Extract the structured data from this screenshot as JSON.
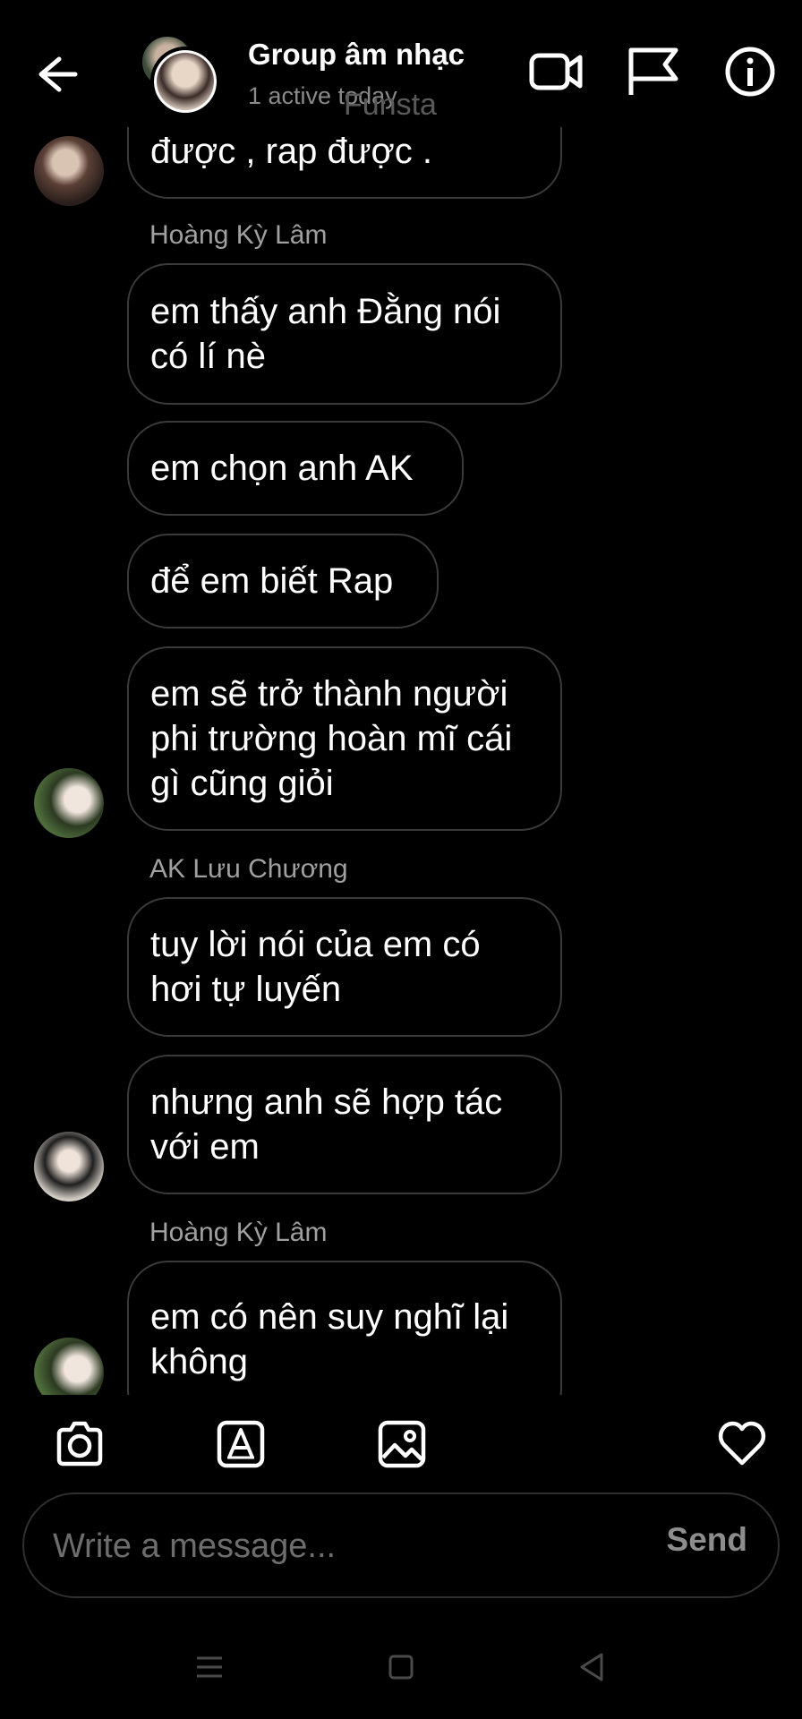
{
  "header": {
    "title": "Group âm nhạc",
    "subtitle": "1 active today",
    "watermark": "Funsta"
  },
  "messages": [
    {
      "type": "bubble",
      "text": "được , rap được ."
    },
    {
      "type": "sender",
      "text": "Hoàng Kỳ Lâm"
    },
    {
      "type": "bubble",
      "text": "em thấy anh Đằng nói có lí nè"
    },
    {
      "type": "bubble",
      "text": "em chọn anh AK"
    },
    {
      "type": "bubble",
      "text": "để em biết Rap"
    },
    {
      "type": "bubble",
      "text": "em sẽ trở thành người phi trường hoàn mĩ cái gì cũng giỏi"
    },
    {
      "type": "sender",
      "text": "AK Lưu Chương"
    },
    {
      "type": "bubble",
      "text": "tuy lời nói của em có hơi tự luyến"
    },
    {
      "type": "bubble",
      "text": "nhưng anh sẽ hợp tác với em"
    },
    {
      "type": "sender",
      "text": "Hoàng Kỳ Lâm"
    },
    {
      "type": "bubble",
      "text": "em có nên suy nghĩ lại không"
    }
  ],
  "composer": {
    "placeholder": "Write a message...",
    "send_label": "Send"
  },
  "icons": {
    "back": "arrow-left-icon",
    "video": "video-call-icon",
    "flag": "flag-icon",
    "info": "info-icon",
    "camera": "camera-icon",
    "sticker": "sticker-icon",
    "gallery": "gallery-icon",
    "like": "heart-icon"
  },
  "colors": {
    "background": "#000000",
    "bubble_border": "#3a3a3a",
    "secondary_text": "#a0a0a0"
  }
}
